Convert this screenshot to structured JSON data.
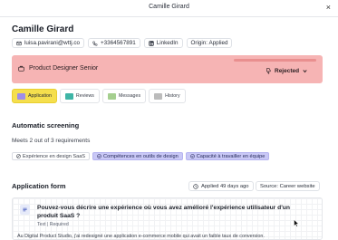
{
  "window": {
    "title": "Camille Girard",
    "close_glyph": "×"
  },
  "candidate": {
    "name": "Camille Girard",
    "email": "luisa.pavirani@wttj.co",
    "phone": "+3364567891",
    "linkedin": "LinkedIn",
    "origin": "Origin: Applied"
  },
  "job": {
    "title": "Product Designer Senior",
    "status": "Rejected",
    "progress_fraction": 1.0,
    "color": "#f6b4b4"
  },
  "tabs": [
    {
      "label": "Application",
      "active": true,
      "icon": "folder-icon",
      "color": "#9f8ee8"
    },
    {
      "label": "Reviews",
      "active": false,
      "icon": "folder-icon",
      "color": "#3fb5a6"
    },
    {
      "label": "Messages",
      "active": false,
      "icon": "folder-icon",
      "color": "#a5cf8f"
    },
    {
      "label": "History",
      "active": false,
      "icon": "folder-icon",
      "color": "#bcbcbc"
    }
  ],
  "screening": {
    "heading": "Automatic screening",
    "summary": "Meets 2 out of 3 requirements",
    "skills": [
      {
        "label": "Expérience en design SaaS",
        "matched": false
      },
      {
        "label": "Compétences en outils de design",
        "matched": true
      },
      {
        "label": "Capacité à travailler en équipe",
        "matched": true
      }
    ]
  },
  "application_form": {
    "heading": "Application form",
    "applied": "Applied 49 days ago",
    "source": "Source: Career website",
    "question": "Pouvez-vous décrire une expérience où vous avez amélioré l'expérience utilisateur d'un produit SaaS ?",
    "question_meta": "Text | Required",
    "answer": "Au Digital Product Studio, j'ai redesigné une application e-commerce mobile qui avait un faible taux de conversion."
  }
}
